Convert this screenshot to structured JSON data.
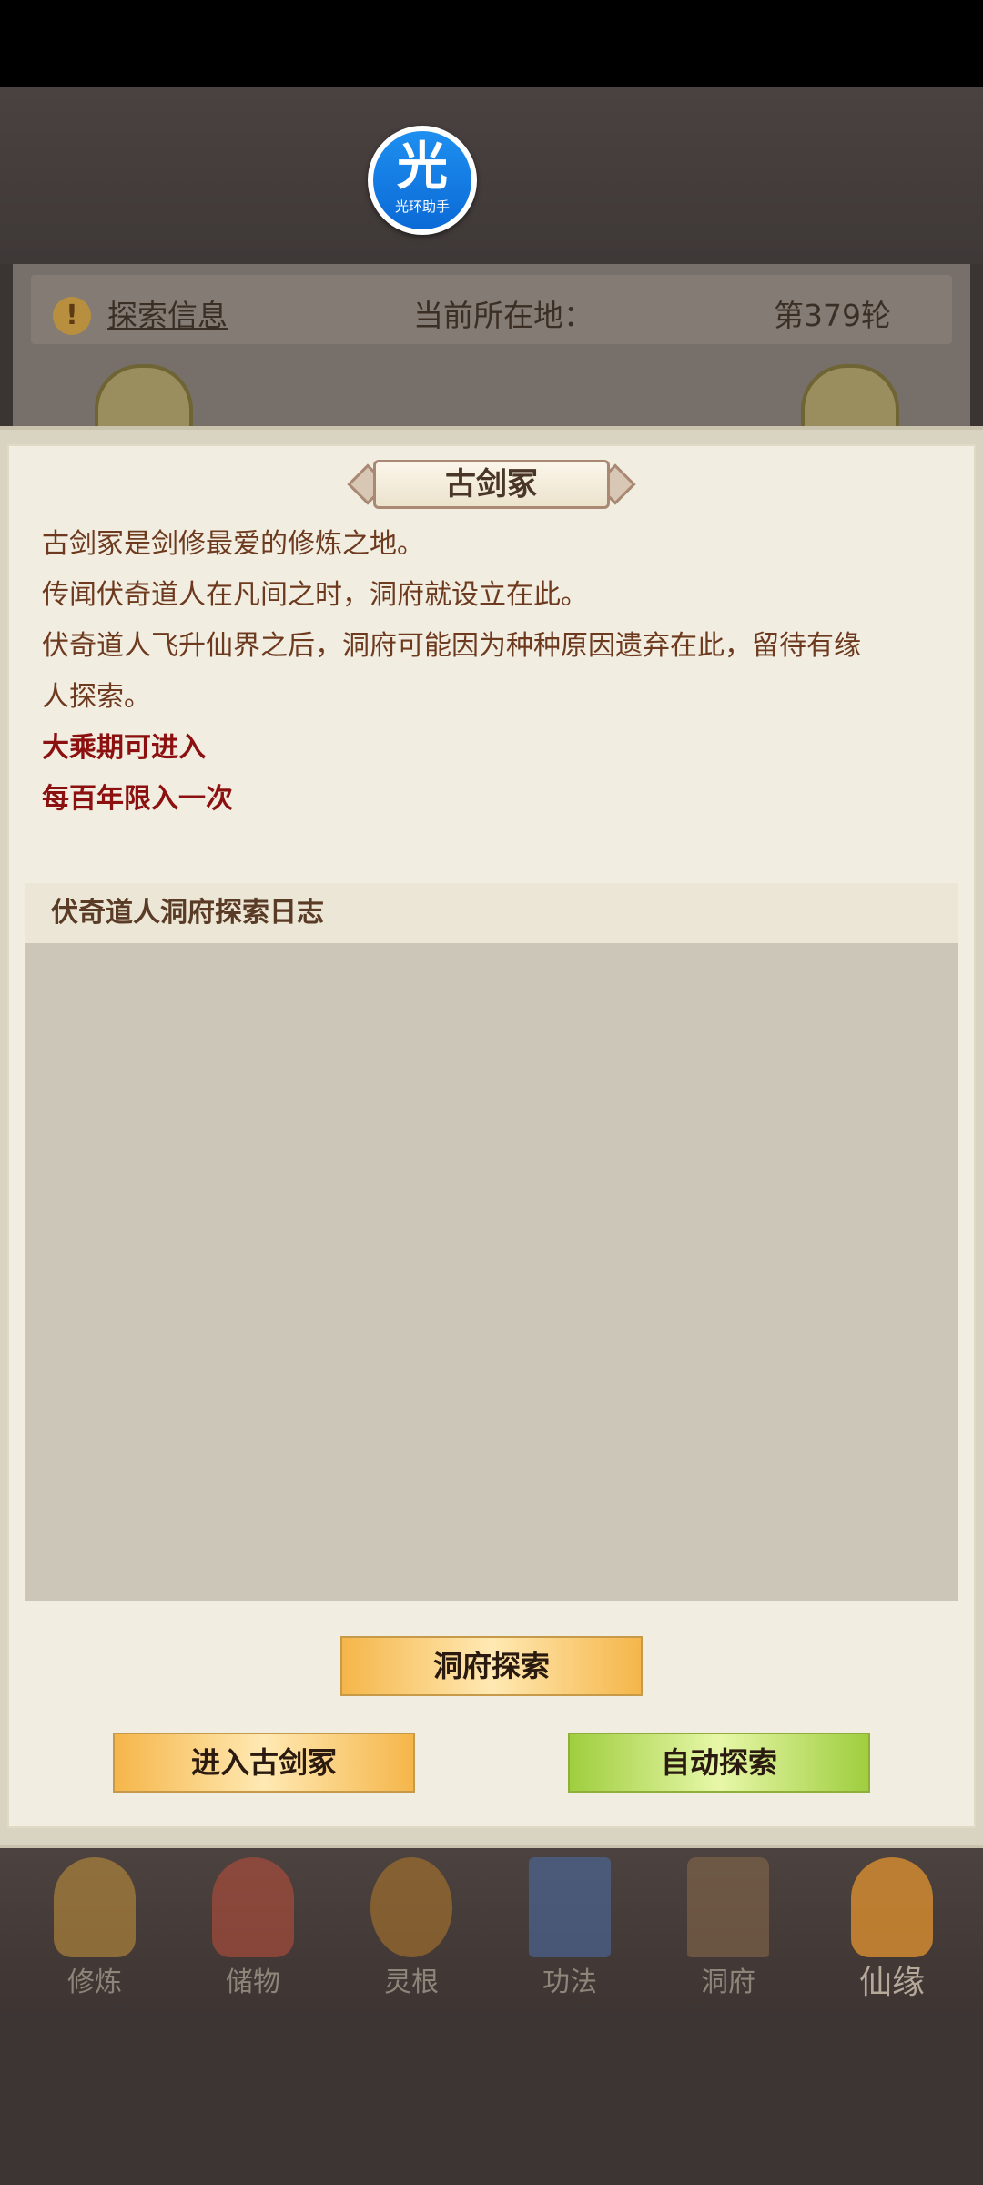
{
  "helper": {
    "char": "光",
    "name": "光环助手"
  },
  "info_bar": {
    "icon": "warning-icon",
    "label": "探索信息",
    "location": "当前所在地：",
    "round": "第379轮"
  },
  "title": "古剑冢",
  "description": {
    "lines": [
      "古剑冢是剑修最爱的修炼之地。",
      "传闻伏奇道人在凡间之时，洞府就设立在此。",
      "伏奇道人飞升仙界之后，洞府可能因为种种原因遗弃在此，留待有缘",
      "人探索。"
    ],
    "requirements": [
      "大乘期可进入",
      "每百年限入一次"
    ]
  },
  "log": {
    "title": "伏奇道人洞府探索日志"
  },
  "buttons": {
    "explore": "洞府探索",
    "enter": "进入古剑冢",
    "auto": "自动探索"
  },
  "nav": {
    "tabs": [
      {
        "label": "修炼",
        "icon": "cultivate-icon",
        "color": "#c9953a"
      },
      {
        "label": "储物",
        "icon": "storage-bag-icon",
        "color": "#c0503a"
      },
      {
        "label": "灵根",
        "icon": "spirit-root-icon",
        "color": "#b47a2a"
      },
      {
        "label": "功法",
        "icon": "technique-book-icon",
        "color": "#4a6fa8"
      },
      {
        "label": "洞府",
        "icon": "cave-palace-icon",
        "color": "#8a6a4a"
      },
      {
        "label": "仙缘",
        "icon": "immortal-fate-icon",
        "color": "#d08a30"
      }
    ],
    "active_index": 5
  }
}
